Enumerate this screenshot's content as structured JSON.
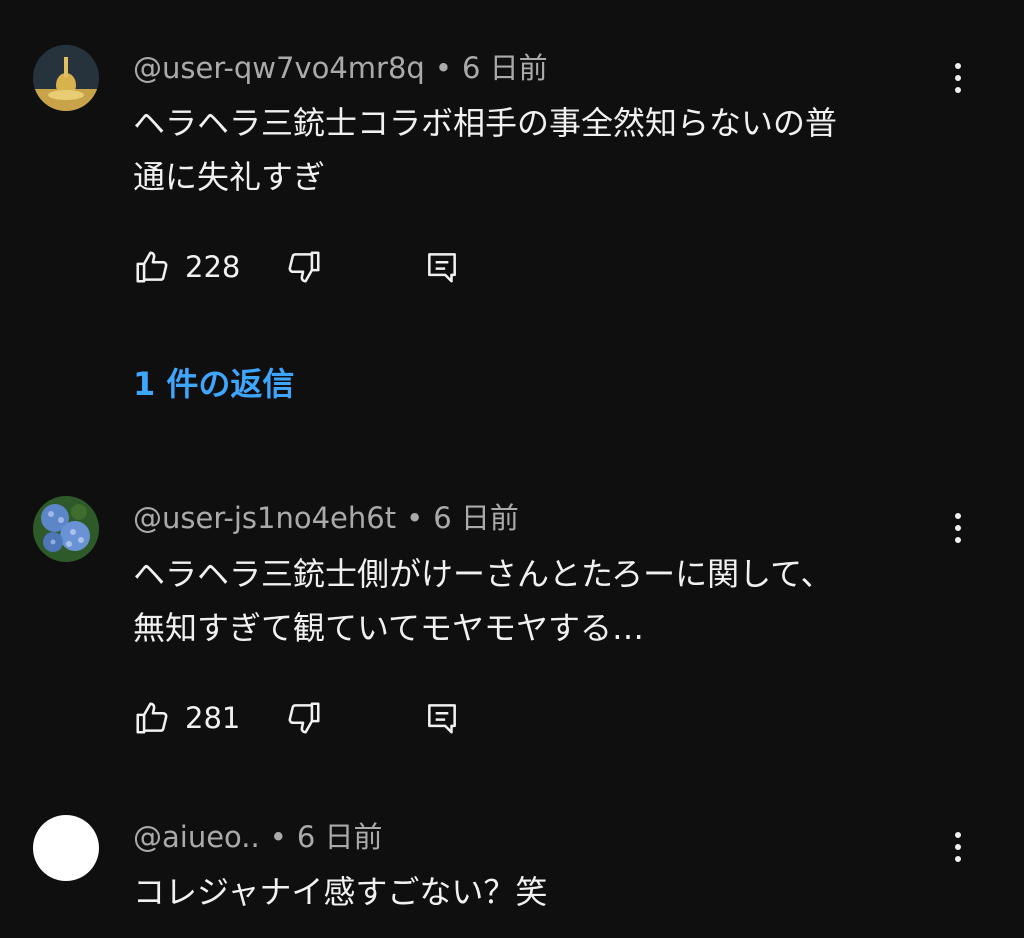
{
  "comments": [
    {
      "author": "@user-qw7vo4mr8q",
      "separator": "•",
      "time": "6 日前",
      "text": "ヘラヘラ三銃士コラボ相手の事全然知らないの普\n通に失礼すぎ",
      "likes": "228",
      "avatar": "figure-on-gold-avatar",
      "replies": "1 件の返信"
    },
    {
      "author": "@user-js1no4eh6t",
      "separator": "•",
      "time": "6 日前",
      "text": "ヘラヘラ三銃士側がけーさんとたろーに関して、\n無知すぎて観ていてモヤモヤする…",
      "likes": "281",
      "avatar": "hydrangea-avatar"
    },
    {
      "author": "@aiueo..",
      "separator": "•",
      "time": "6 日前",
      "text": "コレジャナイ感すごない？笑",
      "avatar": "blank-white-avatar"
    }
  ],
  "icons": {
    "like": "thumbs-up-icon",
    "dislike": "thumbs-down-icon",
    "reply": "comment-icon",
    "more": "more-vertical-icon"
  },
  "colors": {
    "background": "#0f0f0f",
    "text_primary": "#f1f1f1",
    "text_secondary": "#aaaaaa",
    "link": "#3ea6ff"
  }
}
